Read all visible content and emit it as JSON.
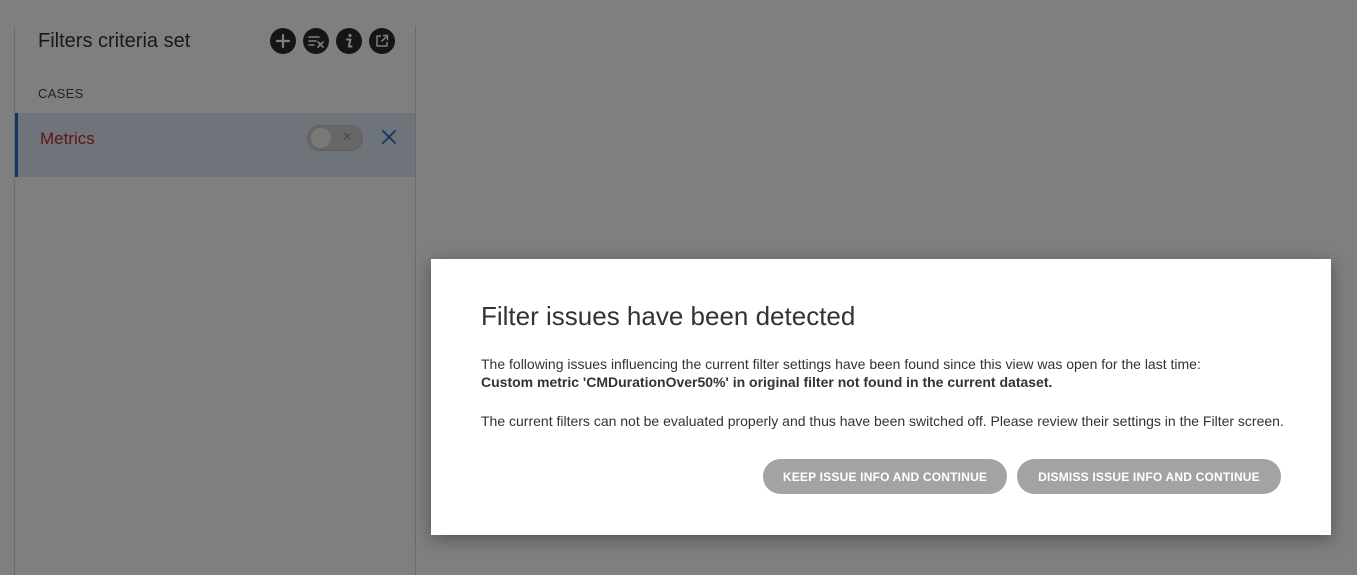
{
  "panel": {
    "title": "Filters criteria set",
    "toolbar": [
      {
        "icon": "plus-icon"
      },
      {
        "icon": "clear-filters-icon"
      },
      {
        "icon": "info-icon"
      },
      {
        "icon": "export-icon"
      }
    ],
    "section_label": "CASES",
    "filter": {
      "name": "Metrics",
      "enabled": false,
      "toggle_mark": "✕"
    }
  },
  "dialog": {
    "title": "Filter issues have been detected",
    "line1": "The following issues influencing the current filter settings have been found since this view was open for the last time:",
    "line2": "Custom metric 'CMDurationOver50%' in original filter not found in the current dataset.",
    "line3": "The current filters can not be evaluated properly and thus have been switched off. Please review their settings in the Filter screen.",
    "keep_label": "KEEP ISSUE INFO AND CONTINUE",
    "dismiss_label": "DISMISS ISSUE INFO AND CONTINUE"
  },
  "colors": {
    "accent": "#1f6fbf",
    "filter_name": "#c62828",
    "button_bg": "#a3a3a3",
    "overlay": "rgba(0,0,0,0.5)"
  }
}
